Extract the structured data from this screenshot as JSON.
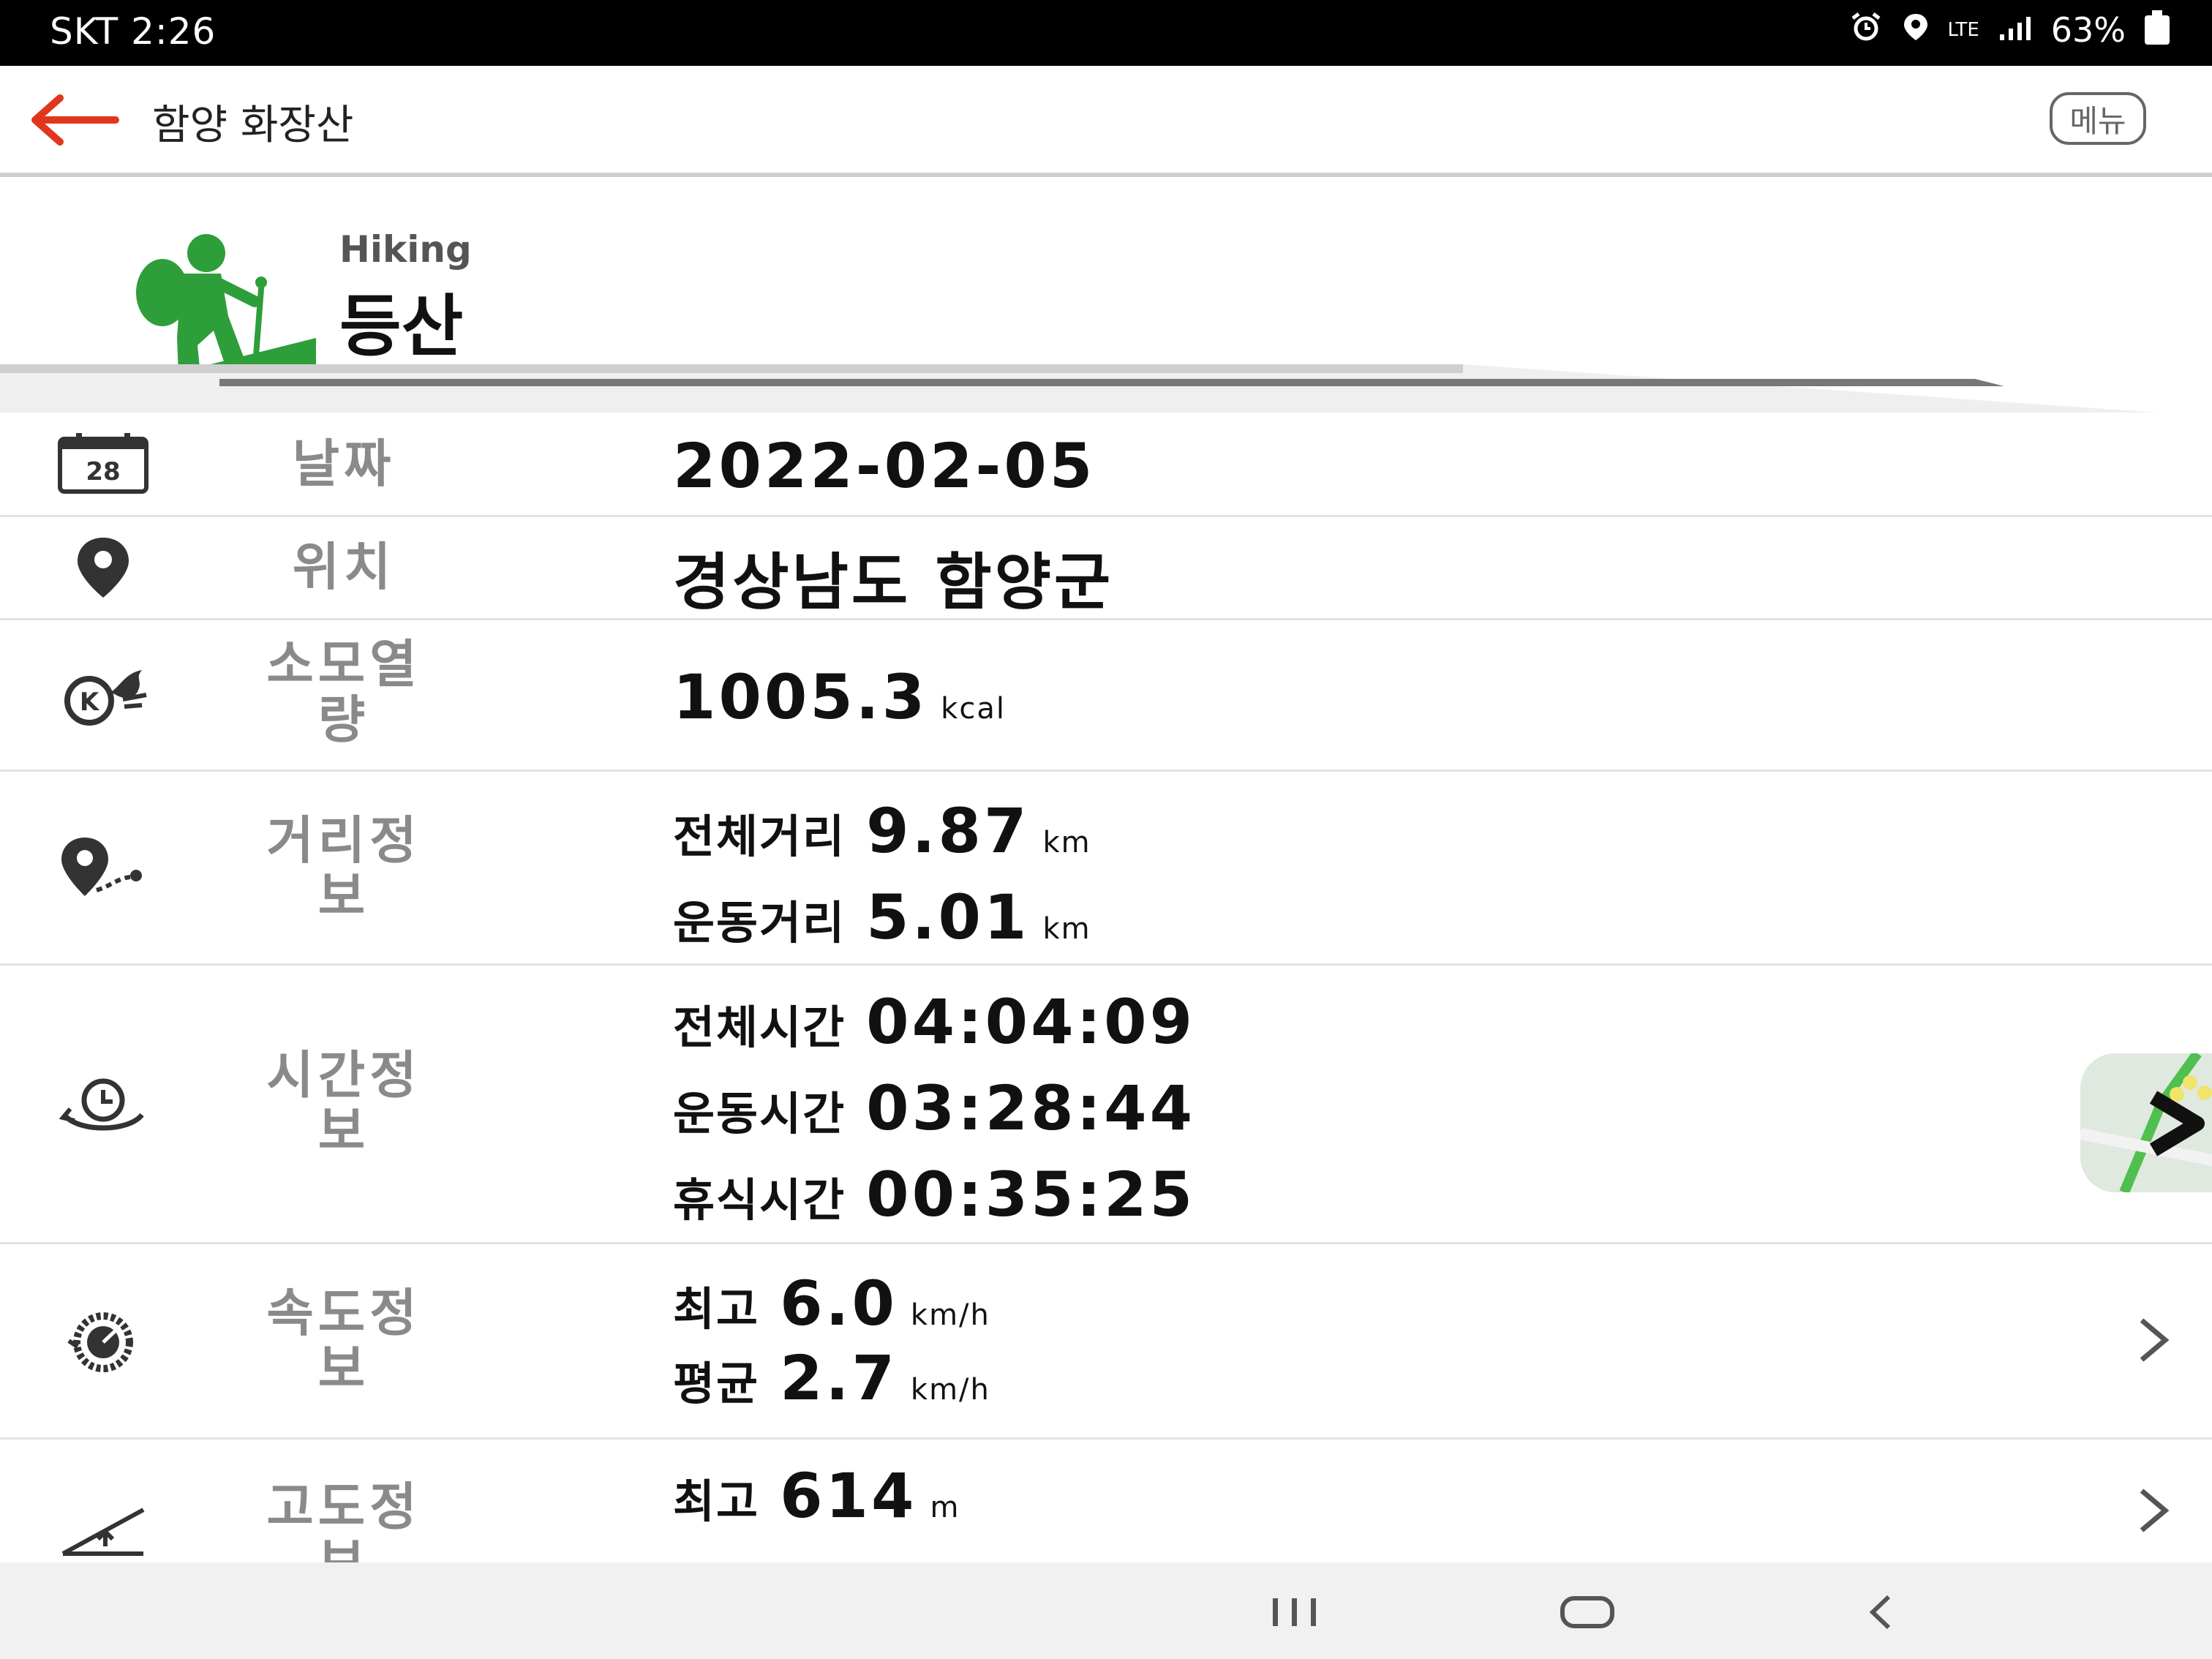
{
  "status": {
    "carrier_time": "SKT 2:26",
    "network": "LTE",
    "battery": "63%"
  },
  "appbar": {
    "title": "함양 화장산",
    "menu_label": "메뉴"
  },
  "activity": {
    "name_en": "Hiking",
    "name_ko": "등산",
    "accent_color": "#2e9e3a"
  },
  "rows": {
    "date": {
      "icon": "calendar-icon",
      "icon_day": "28",
      "label": "날짜",
      "value": "2022-02-05"
    },
    "location": {
      "icon": "location-pin-icon",
      "label": "위치",
      "value": "경상남도 함양군"
    },
    "calories": {
      "icon": "calorie-flame-icon",
      "label_l1": "소모열",
      "label_l2": "량",
      "value": "1005.3",
      "unit": "kcal"
    },
    "distance": {
      "icon": "distance-pin-icon",
      "label_l1": "거리정",
      "label_l2": "보",
      "total_label": "전체거리",
      "total_value": "9.87",
      "total_unit": "km",
      "moving_label": "운동거리",
      "moving_value": "5.01",
      "moving_unit": "km"
    },
    "time": {
      "icon": "clock-icon",
      "label_l1": "시간정",
      "label_l2": "보",
      "total_label": "전체시간",
      "total_value": "04:04:09",
      "moving_label": "운동시간",
      "moving_value": "03:28:44",
      "rest_label": "휴식시간",
      "rest_value": "00:35:25"
    },
    "speed": {
      "icon": "speedometer-icon",
      "label_l1": "속도정",
      "label_l2": "보",
      "max_label": "최고",
      "max_value": "6.0",
      "max_unit": "km/h",
      "avg_label": "평균",
      "avg_value": "2.7",
      "avg_unit": "km/h"
    },
    "altitude": {
      "icon": "altitude-icon",
      "label_l1": "고도정",
      "label_l2": "보",
      "max_label": "최고",
      "max_value": "614",
      "max_unit": "m"
    }
  }
}
